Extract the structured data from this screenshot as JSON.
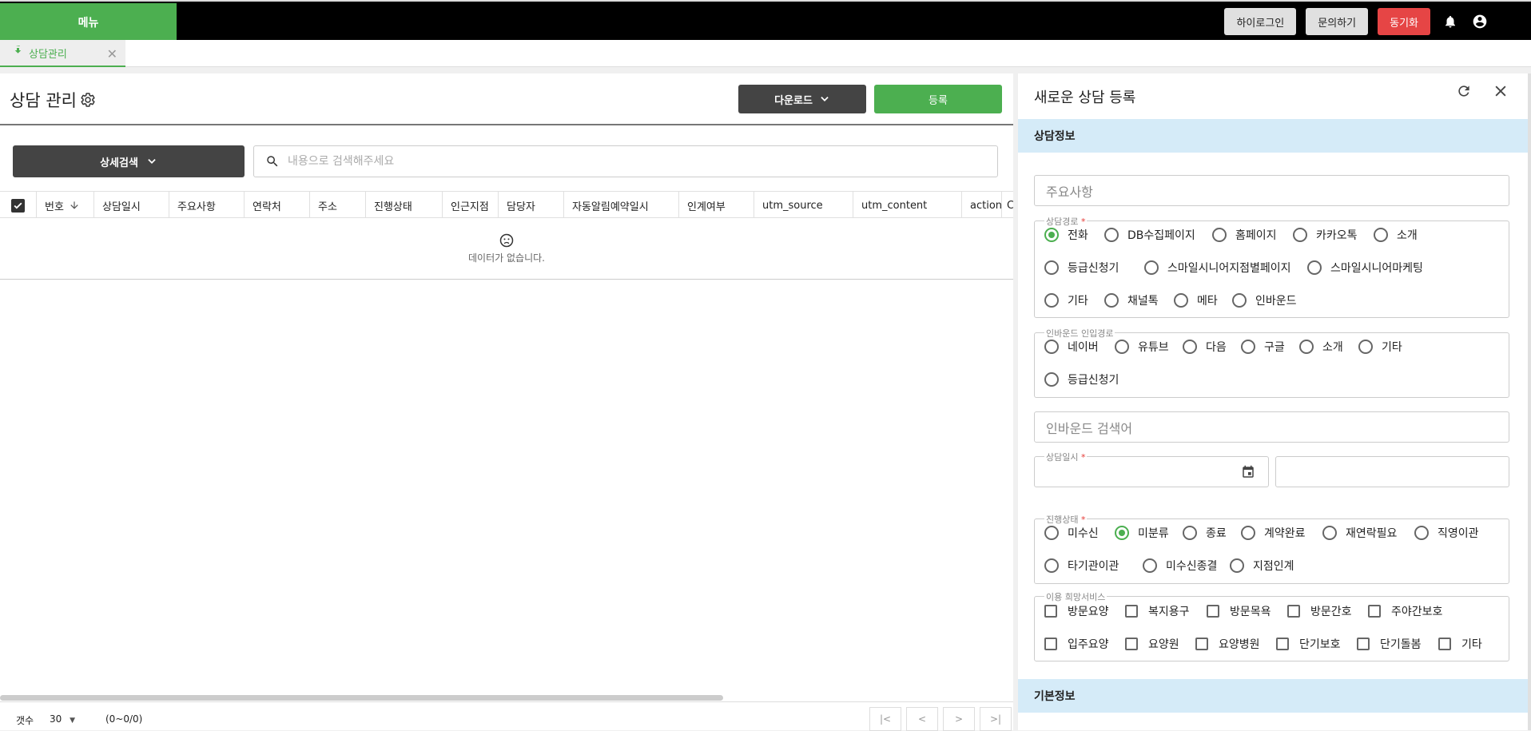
{
  "topbar": {
    "menu_label": "메뉴",
    "buttons": [
      {
        "label": "하이로그인",
        "variant": "default"
      },
      {
        "label": "문의하기",
        "variant": "default"
      },
      {
        "label": "동기화",
        "variant": "danger"
      }
    ],
    "icons": [
      "bell-icon",
      "account-circle-icon"
    ]
  },
  "tabs": [
    {
      "label": "상담관리",
      "icon": "phone-callback-icon",
      "active": true
    }
  ],
  "main": {
    "title": "상담 관리",
    "download_label": "다운로드",
    "register_label": "등록",
    "advanced_search_label": "상세검색",
    "search_placeholder": "내용으로 검색해주세요",
    "columns": [
      "번호",
      "상담일시",
      "주요사항",
      "연락처",
      "주소",
      "진행상태",
      "인근지점",
      "담당자",
      "자동알림예약일시",
      "인계여부",
      "utm_source",
      "utm_content",
      "action",
      "C"
    ],
    "sorted_column": "번호",
    "empty_text": "데이터가 없습니다.",
    "footer": {
      "count_label": "갯수",
      "page_size": "30",
      "range": "(0~0/0)"
    }
  },
  "form": {
    "title": "새로운 상담 등록",
    "section_info": "상담정보",
    "section_basic": "기본정보",
    "main_issue_placeholder": "주요사항",
    "channel": {
      "legend": "상담경로",
      "required": true,
      "options": [
        "전화",
        "DB수집페이지",
        "홈페이지",
        "카카오톡",
        "소개",
        "등급신청기",
        "스마일시니어지점별페이지",
        "스마일시니어마케팅",
        "기타",
        "채널톡",
        "메타",
        "인바운드"
      ],
      "selected": "전화"
    },
    "inbound_route": {
      "legend": "인바운드 인입경로",
      "options": [
        "네이버",
        "유튜브",
        "다음",
        "구글",
        "소개",
        "기타",
        "등급신청기"
      ],
      "selected": null
    },
    "inbound_keyword_placeholder": "인바운드 검색어",
    "datetime": {
      "legend": "상담일시",
      "required": true,
      "date_value": "",
      "time_value": ""
    },
    "status": {
      "legend": "진행상태",
      "required": true,
      "options": [
        "미수신",
        "미분류",
        "종료",
        "계약완료",
        "재연락필요",
        "직영이관",
        "타기관이관",
        "미수신종결",
        "지점인계"
      ],
      "selected": "미분류"
    },
    "services": {
      "legend": "이용 희망서비스",
      "options": [
        "방문요양",
        "복지용구",
        "방문목욕",
        "방문간호",
        "주야간보호",
        "입주요양",
        "요양원",
        "요양병원",
        "단기보호",
        "단기돌봄",
        "기타"
      ],
      "checked": []
    }
  },
  "colors": {
    "brand_green": "#4caf50",
    "danger_red": "#e64545",
    "dark_button": "#444444",
    "section_band": "#d5ebf8"
  }
}
